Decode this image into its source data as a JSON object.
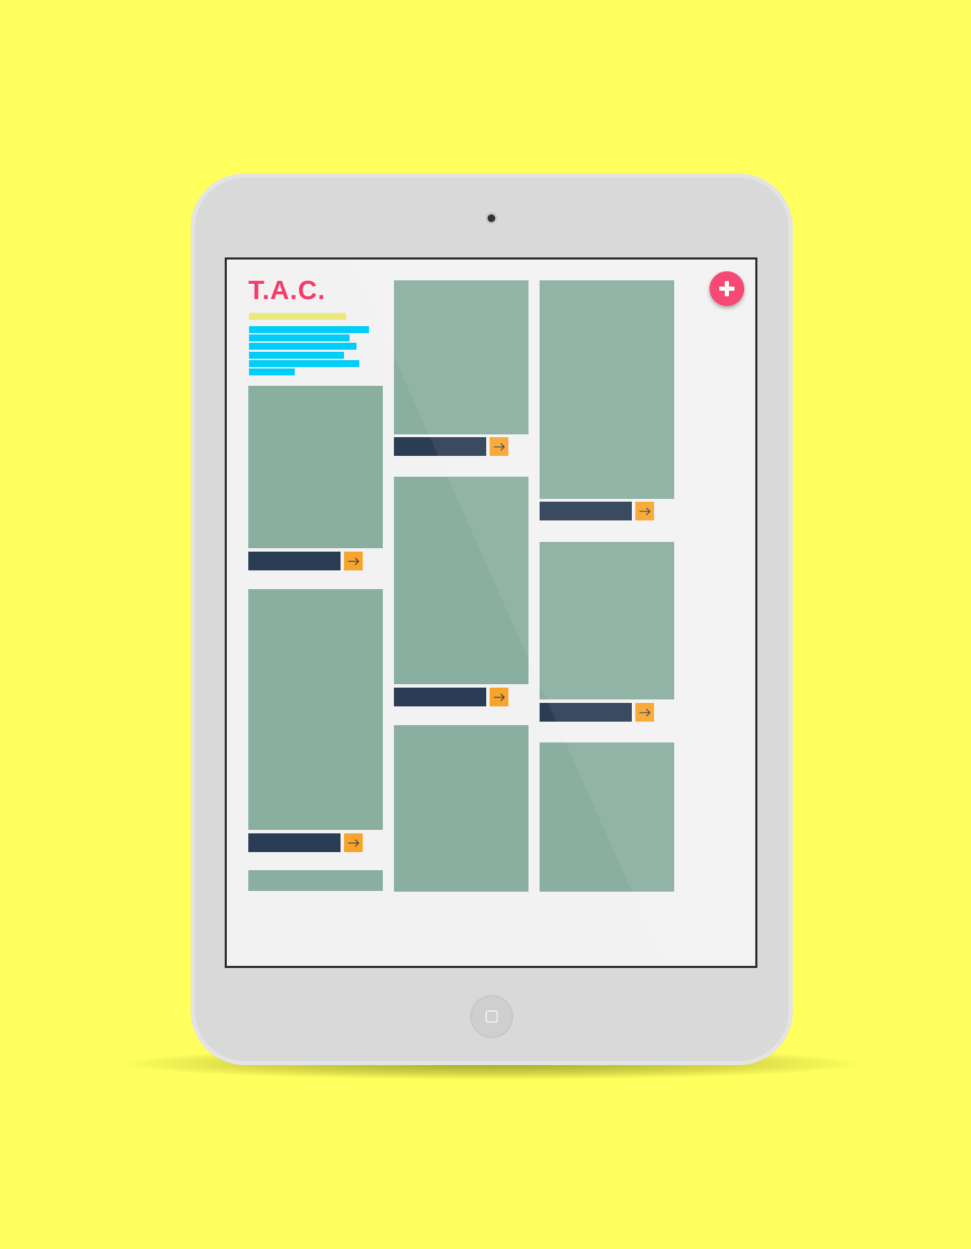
{
  "app": {
    "logo_text": "T.A.C."
  },
  "colors": {
    "background": "#ffff5e",
    "logo": "#f83a6a",
    "fab": "#f83a6a",
    "subtitle_bar": "#ece87b",
    "text_lines": "#00cef8",
    "card_image": "#8aae9f",
    "card_caption": "#2b3c55",
    "card_arrow": "#f7a42c"
  },
  "icons": {
    "fab": "plus-icon",
    "card_arrow": "arrow-right-icon",
    "home": "home-button-icon",
    "camera": "camera-icon"
  }
}
